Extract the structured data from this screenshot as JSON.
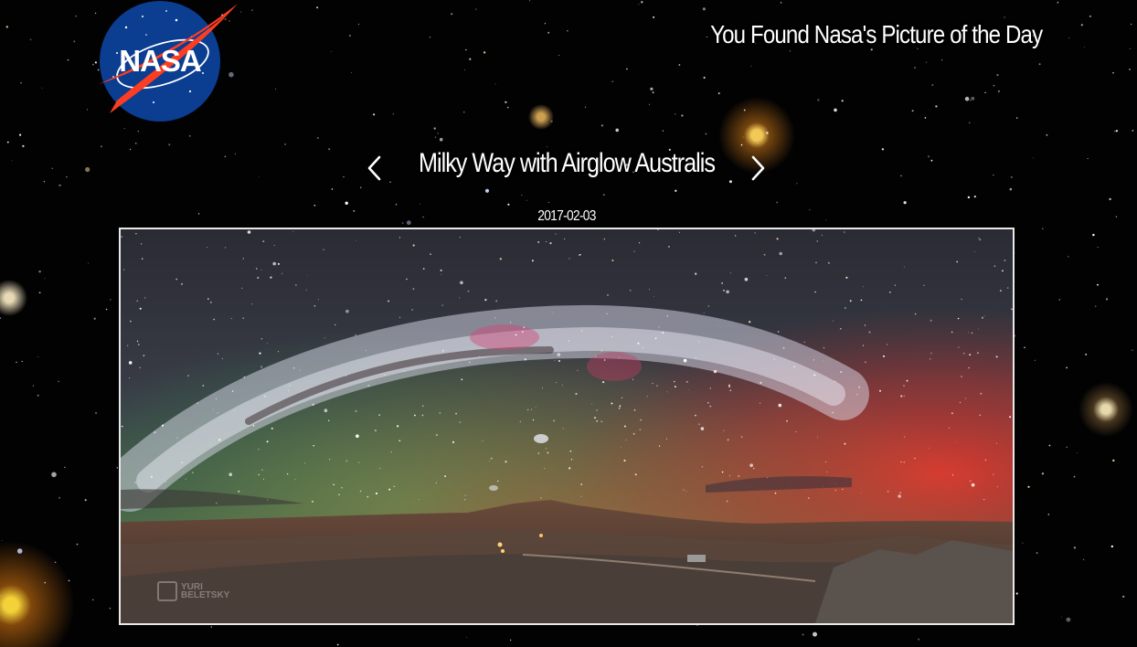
{
  "app": {
    "logo": {
      "text": "NASA",
      "icon": "nasa-meatball-logo"
    },
    "header_title": "You Found Nasa's Picture of the Day"
  },
  "apod": {
    "title": "Milky Way with Airglow Australis",
    "date": "2017-02-03",
    "prev_icon": "chevron-left-icon",
    "next_icon": "chevron-right-icon",
    "watermark": "YURI BELETSKY"
  },
  "colors": {
    "background": "#020203",
    "text": "#ffffff",
    "frame_border": "#e9e9e9",
    "logo_blue": "#0b3d91",
    "logo_red": "#fc3d21"
  }
}
